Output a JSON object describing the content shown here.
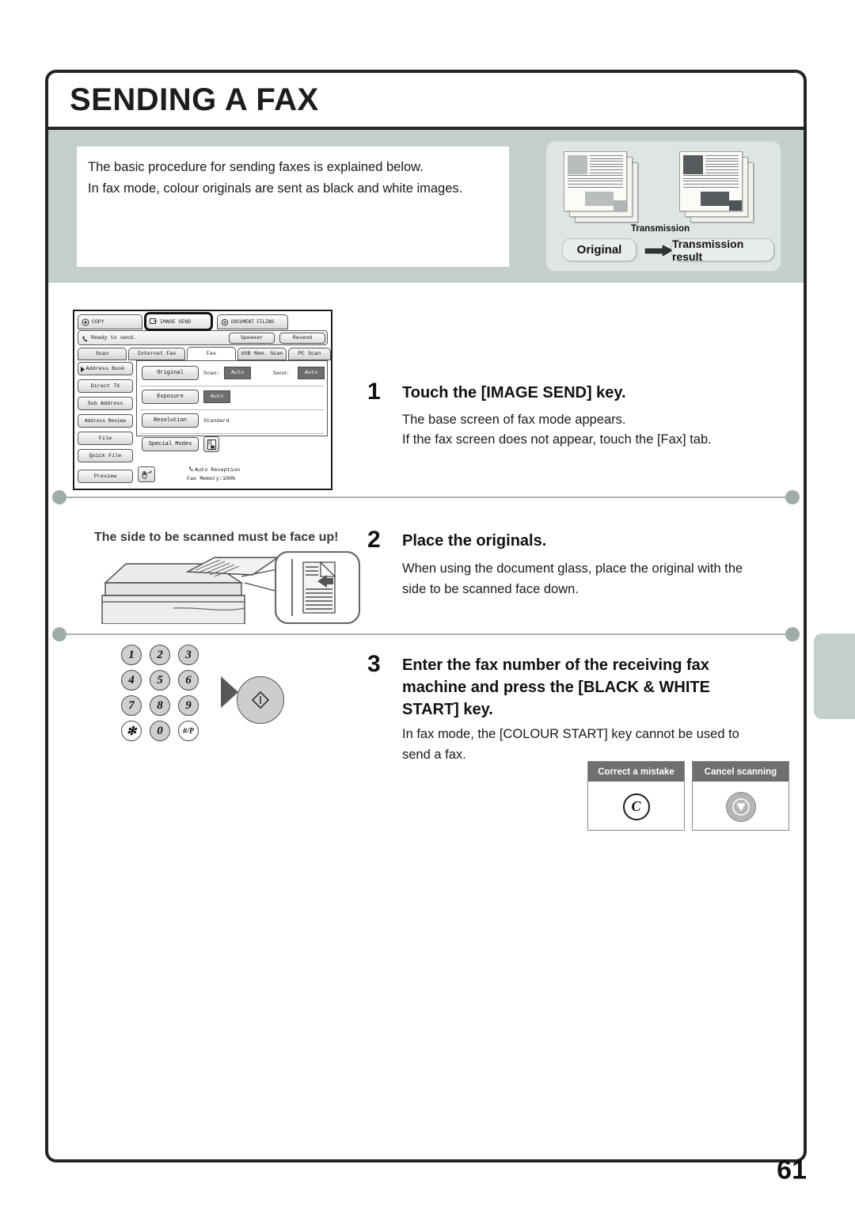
{
  "page": {
    "title": "SENDING A FAX",
    "number": "61"
  },
  "intro": {
    "line1": "The basic procedure for sending faxes is explained below.",
    "line2": "In fax mode, colour originals are sent as black and white images."
  },
  "illustration": {
    "transmission_label": "Transmission",
    "original_label": "Original",
    "result_label": "Transmission result"
  },
  "steps": [
    {
      "number": "1",
      "heading": "Touch the [IMAGE SEND] key.",
      "body_line1": "The base screen of fax mode appears.",
      "body_line2": "If the fax screen does not appear, touch the [Fax] tab."
    },
    {
      "number": "2",
      "heading": "Place the originals.",
      "body_line1": "When using the document glass, place the original with the",
      "body_line2": "side to be scanned face down.",
      "caption": "The side to be scanned must be face up!"
    },
    {
      "number": "3",
      "heading_line1": "Enter the fax number of the receiving fax",
      "heading_line2": "machine and press the [BLACK & WHITE",
      "heading_line3": "START] key.",
      "body_line1": "In fax mode, the [COLOUR START] key cannot be used to",
      "body_line2": "send a fax."
    }
  ],
  "lcd": {
    "mode_tabs": [
      {
        "label": "COPY",
        "icon": "copy-icon",
        "selected": false
      },
      {
        "label": "IMAGE SEND",
        "icon": "image-send-icon",
        "selected": true
      },
      {
        "label": "DOCUMENT FILING",
        "icon": "document-filing-icon",
        "selected": false
      }
    ],
    "status_text": "Ready to send.",
    "status_icon": "phone-icon",
    "top_buttons": [
      "Speaker",
      "Resend"
    ],
    "function_tabs": [
      {
        "label": "Scan",
        "active": false
      },
      {
        "label": "Internet Fax",
        "active": false
      },
      {
        "label": "Fax",
        "active": true
      },
      {
        "label": "USB Mem. Scan",
        "active": false
      },
      {
        "label": "PC Scan",
        "active": false
      }
    ],
    "side_buttons": [
      "Address Book",
      "Direct TX",
      "Sub Address",
      "Address Review",
      "File",
      "Quick File",
      "Preview"
    ],
    "settings_rows": [
      {
        "button": "Original",
        "label1": "Scan:",
        "value1": "Auto",
        "label2": "Send:",
        "value2": "Auto"
      },
      {
        "button": "Exposure",
        "value1": "Auto"
      },
      {
        "button": "Resolution",
        "plain_value": "Standard"
      },
      {
        "button": "Special Modes",
        "icon": "info-icon"
      }
    ],
    "footer": {
      "icon": "send-hand-icon",
      "line1": "Auto Reception",
      "line2": "Fax Memory:100%",
      "reception_icon": "phone-icon"
    }
  },
  "keypad": {
    "keys": [
      "1",
      "2",
      "3",
      "4",
      "5",
      "6",
      "7",
      "8",
      "9",
      "✻",
      "0",
      "#/P"
    ],
    "start_key_icon": "start-diamond-icon",
    "arrow_icon": "right-triangle-icon"
  },
  "key_notes": [
    {
      "title": "Correct a mistake",
      "glyph": "C",
      "icon": "clear-key-icon"
    },
    {
      "title": "Cancel scanning",
      "glyph": "",
      "icon": "stop-key-icon"
    }
  ],
  "colors": {
    "band": "#c3cfcd",
    "frame": "#232323",
    "note_header": "#6f6f6f"
  }
}
